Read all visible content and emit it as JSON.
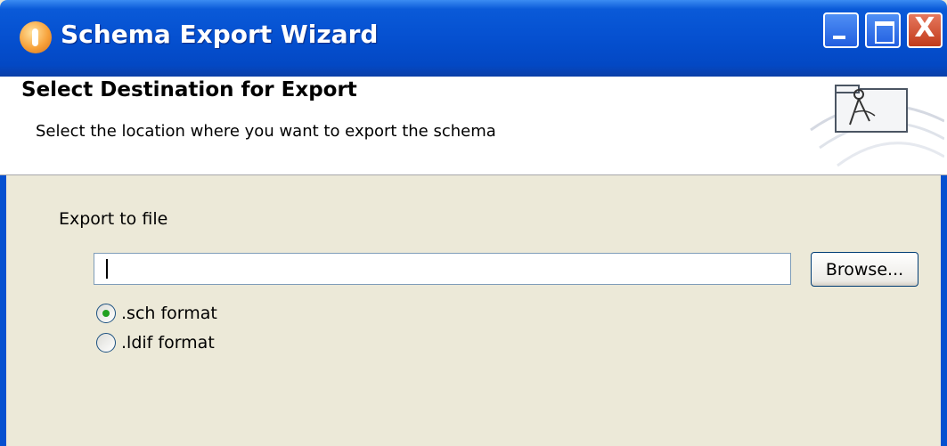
{
  "window": {
    "title": "Schema Export Wizard",
    "close_glyph": "X"
  },
  "banner": {
    "title": "Select Destination for Export",
    "subtitle": "Select the location where you want to export the schema",
    "icon": "compass-folder-icon"
  },
  "form": {
    "export_label": "Export to file",
    "file_value": "",
    "browse_label": "Browse...",
    "formats": [
      {
        "label": ".sch format",
        "checked": true
      },
      {
        "label": ".ldif format",
        "checked": false
      }
    ]
  },
  "colors": {
    "titlebar": "#0550d0",
    "body": "#ece9d8",
    "radio_check": "#21a121"
  }
}
